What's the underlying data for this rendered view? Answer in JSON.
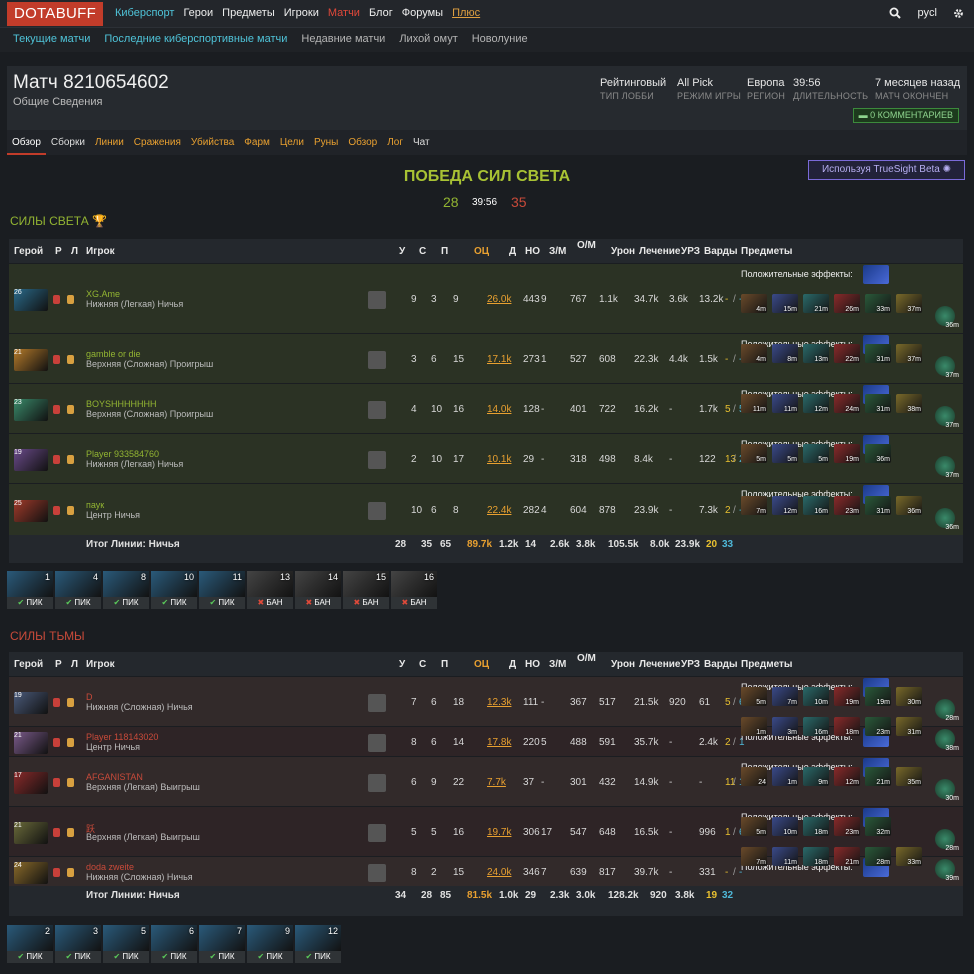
{
  "nav": {
    "logo": "DOTABUFF",
    "items": [
      "Киберспорт",
      "Герои",
      "Предметы",
      "Игроки",
      "Матчи",
      "Блог",
      "Форумы",
      "Плюс"
    ],
    "user": "pycl"
  },
  "subnav": [
    "Текущие матчи",
    "Последние киберспортивные матчи",
    "Недавние матчи",
    "Лихой омут",
    "Новолуние"
  ],
  "match": {
    "title": "Матч 8210654602",
    "subtitle": "Общие Сведения",
    "meta": [
      {
        "v": "Рейтинговый",
        "l": "ТИП ЛОББИ"
      },
      {
        "v": "All Pick",
        "l": "РЕЖИМ ИГРЫ"
      },
      {
        "v": "Европа",
        "l": "РЕГИОН"
      },
      {
        "v": "39:56",
        "l": "ДЛИТЕЛЬНОСТЬ"
      },
      {
        "v": "7 месяцев назад",
        "l": "МАТЧ ОКОНЧЕН"
      }
    ],
    "comments": "0 КОММЕНТАРИЕВ"
  },
  "tabs": [
    "Обзор",
    "Сборки",
    "Линии",
    "Сражения",
    "Убийства",
    "Фарм",
    "Цели",
    "Руны",
    "Обзор",
    "Лог",
    "Чат"
  ],
  "truesight": "Используя TrueSight Beta",
  "result": {
    "text": "ПОБЕДА СИЛ СВЕТА",
    "radiant_score": "28",
    "time": "39:56",
    "dire_score": "35"
  },
  "headers": {
    "hero": "Герой",
    "r": "Р",
    "l": "Л",
    "player": "Игрок",
    "k": "У",
    "d": "С",
    "a": "П",
    "nw": "ОЦ",
    "lh": "Д",
    "dn": "НО",
    "gpm": "З/М",
    "xpm": "О/М",
    "dmg": "Урон",
    "heal": "Лечение",
    "bld": "УРЗ",
    "wards": "Варды",
    "items": "Предметы"
  },
  "buffs_label": "Положительные эффекты:",
  "radiant": {
    "title": "СИЛЫ СВЕТА",
    "players": [
      {
        "lvl": "26",
        "name": "XG.Ame",
        "lane": "Нижняя (Легкая) Ничья",
        "k": "9",
        "d": "3",
        "a": "9",
        "nw": "26.0k",
        "lh": "443",
        "dn": "9",
        "gpm": "767",
        "xpm": "1.1k",
        "dmg": "34.7k",
        "heal": "3.6k",
        "bld": "13.2k",
        "wards": "-",
        "wards2": "-",
        "times": [
          "4m",
          "15m",
          "21m",
          "26m",
          "33m",
          "37m",
          "",
          "36m"
        ]
      },
      {
        "lvl": "21",
        "name": "gamble or die",
        "lane": "Верхняя (Сложная) Проигрыш",
        "k": "3",
        "d": "6",
        "a": "15",
        "nw": "17.1k",
        "lh": "273",
        "dn": "1",
        "gpm": "527",
        "xpm": "608",
        "dmg": "22.3k",
        "heal": "4.4k",
        "bld": "1.5k",
        "wards": "-",
        "wards2": "-",
        "times": [
          "4m",
          "8m",
          "13m",
          "22m",
          "31m",
          "37m",
          "37m"
        ]
      },
      {
        "lvl": "23",
        "name": "BOYSHHHHHHH",
        "lane": "Верхняя (Сложная) Проигрыш",
        "k": "4",
        "d": "10",
        "a": "16",
        "nw": "14.0k",
        "lh": "128",
        "dn": "-",
        "gpm": "401",
        "xpm": "722",
        "dmg": "16.2k",
        "heal": "-",
        "bld": "1.7k",
        "wards": "5",
        "wards2": "5",
        "times": [
          "11m",
          "11m",
          "12m",
          "24m",
          "31m",
          "38m",
          "37m"
        ]
      },
      {
        "lvl": "19",
        "name": "Player 933584760",
        "lane": "Нижняя (Легкая) Ничья",
        "k": "2",
        "d": "10",
        "a": "17",
        "nw": "10.1k",
        "lh": "29",
        "dn": "-",
        "gpm": "318",
        "xpm": "498",
        "dmg": "8.4k",
        "heal": "-",
        "bld": "122",
        "wards": "13",
        "wards2": "28",
        "times": [
          "5m",
          "5m",
          "5m",
          "19m",
          "36m",
          "37m"
        ]
      },
      {
        "lvl": "25",
        "name": "паук",
        "lane": "Центр Ничья",
        "k": "10",
        "d": "6",
        "a": "8",
        "nw": "22.4k",
        "lh": "282",
        "dn": "4",
        "gpm": "604",
        "xpm": "878",
        "dmg": "23.9k",
        "heal": "-",
        "bld": "7.3k",
        "wards": "2",
        "wards2": "-",
        "times": [
          "7m",
          "12m",
          "16m",
          "23m",
          "31m",
          "36m",
          "36m"
        ]
      }
    ],
    "total": {
      "label": "Итог Линии: Ничья",
      "k": "28",
      "d": "35",
      "a": "65",
      "nw": "89.7k",
      "lh": "1.2k",
      "dn": "14",
      "gpm": "2.6k",
      "xpm": "3.8k",
      "dmg": "105.5k",
      "heal": "8.0k",
      "bld": "23.9k",
      "wards": "20",
      "wards2": "33"
    },
    "picks": [
      {
        "n": "1",
        "t": "ПИК"
      },
      {
        "n": "4",
        "t": "ПИК"
      },
      {
        "n": "8",
        "t": "ПИК"
      },
      {
        "n": "10",
        "t": "ПИК"
      },
      {
        "n": "11",
        "t": "ПИК"
      },
      {
        "n": "13",
        "t": "БАН"
      },
      {
        "n": "14",
        "t": "БАН"
      },
      {
        "n": "15",
        "t": "БАН"
      },
      {
        "n": "16",
        "t": "БАН"
      }
    ]
  },
  "dire": {
    "title": "СИЛЫ ТЬМЫ",
    "players": [
      {
        "lvl": "19",
        "name": "D",
        "lane": "Нижняя (Сложная) Ничья",
        "k": "7",
        "d": "6",
        "a": "18",
        "nw": "12.3k",
        "lh": "111",
        "dn": "-",
        "gpm": "367",
        "xpm": "517",
        "dmg": "21.5k",
        "heal": "920",
        "bld": "61",
        "wards": "5",
        "wards2": "6",
        "times": [
          "5m",
          "7m",
          "10m",
          "19m",
          "19m",
          "30m",
          "28m"
        ]
      },
      {
        "lvl": "21",
        "name": "Player 118143020",
        "lane": "Центр Ничья",
        "k": "8",
        "d": "6",
        "a": "14",
        "nw": "17.8k",
        "lh": "220",
        "dn": "5",
        "gpm": "488",
        "xpm": "591",
        "dmg": "35.7k",
        "heal": "-",
        "bld": "2.4k",
        "wards": "2",
        "wards2": "1",
        "times": [
          "1m",
          "3m",
          "16m",
          "18m",
          "23m",
          "31m",
          "38m"
        ]
      },
      {
        "lvl": "17",
        "name": "AFGANISTAN",
        "lane": "Верхняя (Легкая) Выигрыш",
        "k": "6",
        "d": "9",
        "a": "22",
        "nw": "7.7k",
        "lh": "37",
        "dn": "-",
        "gpm": "301",
        "xpm": "432",
        "dmg": "14.9k",
        "heal": "-",
        "bld": "-",
        "wards": "11",
        "wards2": "19",
        "times": [
          "24",
          "1m",
          "9m",
          "12m",
          "21m",
          "35m",
          "",
          "30m"
        ]
      },
      {
        "lvl": "21",
        "name": "跃",
        "lane": "Верхняя (Легкая) Выигрыш",
        "k": "5",
        "d": "5",
        "a": "16",
        "nw": "19.7k",
        "lh": "306",
        "dn": "17",
        "gpm": "547",
        "xpm": "648",
        "dmg": "16.5k",
        "heal": "-",
        "bld": "996",
        "wards": "1",
        "wards2": "6",
        "times": [
          "5m",
          "10m",
          "18m",
          "23m",
          "32m",
          "28m"
        ]
      },
      {
        "lvl": "24",
        "name": "doda zweite",
        "lane": "Нижняя (Сложная) Ничья",
        "k": "8",
        "d": "2",
        "a": "15",
        "nw": "24.0k",
        "lh": "346",
        "dn": "7",
        "gpm": "639",
        "xpm": "817",
        "dmg": "39.7k",
        "heal": "-",
        "bld": "331",
        "wards": "-",
        "wards2": "-",
        "times": [
          "7m",
          "11m",
          "18m",
          "21m",
          "28m",
          "33m",
          "39m"
        ]
      }
    ],
    "total": {
      "label": "Итог Линии: Ничья",
      "k": "34",
      "d": "28",
      "a": "85",
      "nw": "81.5k",
      "lh": "1.0k",
      "dn": "29",
      "gpm": "2.3k",
      "xpm": "3.0k",
      "dmg": "128.2k",
      "heal": "920",
      "bld": "3.8k",
      "wards": "19",
      "wards2": "32"
    },
    "picks": [
      {
        "n": "2",
        "t": "ПИК"
      },
      {
        "n": "3",
        "t": "ПИК"
      },
      {
        "n": "5",
        "t": "ПИК"
      },
      {
        "n": "6",
        "t": "ПИК"
      },
      {
        "n": "7",
        "t": "ПИК"
      },
      {
        "n": "9",
        "t": "ПИК"
      },
      {
        "n": "12",
        "t": "ПИК"
      }
    ]
  }
}
